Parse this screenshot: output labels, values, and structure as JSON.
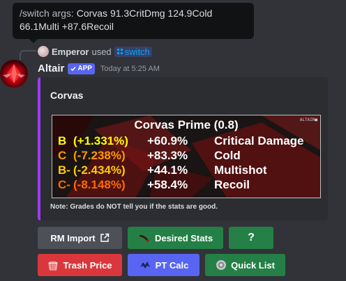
{
  "tooltip": {
    "command": "/switch args:",
    "args_line1": "Corvas 91.3CritDmg 124.9Cold",
    "args_line2": "66.1Multi +87.6Recoil"
  },
  "reply": {
    "user": "Emperor",
    "used_text": "used",
    "command_icon": "slash-command-icon",
    "command": "switch"
  },
  "message": {
    "author": "Altair",
    "badge": "APP",
    "timestamp": "Today at 5:25 AM"
  },
  "embed": {
    "accent_color": "#a03cf4",
    "title": "Corvas",
    "card": {
      "title": "Corvas Prime (0.8)",
      "watermark": "ALTAIR■",
      "rows": [
        {
          "grade": "B",
          "delta": "(+1.331%)",
          "value": "+60.9%",
          "stat": "Critical Damage",
          "color": "#ffff00"
        },
        {
          "grade": "C",
          "delta": "(-7.238%)",
          "value": "+83.3%",
          "stat": "Cold",
          "color": "#ff9900"
        },
        {
          "grade": "B-",
          "delta": "(-2.434%)",
          "value": "+44.1%",
          "stat": "Multishot",
          "color": "#ffcc00"
        },
        {
          "grade": "C-",
          "delta": "(-8.148%)",
          "value": "+58.4%",
          "stat": "Recoil",
          "color": "#ff6a00"
        }
      ]
    },
    "note": "Note: Grades do NOT tell you if the stats are good."
  },
  "buttons": {
    "rm_import": {
      "label": "RM Import",
      "icon": "external-link-icon"
    },
    "desired_stats": {
      "label": "Desired Stats",
      "icon": "weapon-icon"
    },
    "help": {
      "label": "?"
    },
    "trash_price": {
      "label": "Trash Price",
      "icon": "trash-basket-icon"
    },
    "pt_calc": {
      "label": "PT Calc",
      "icon": "creature-icon"
    },
    "quick_list": {
      "label": "Quick List",
      "icon": "ducat-icon"
    }
  }
}
